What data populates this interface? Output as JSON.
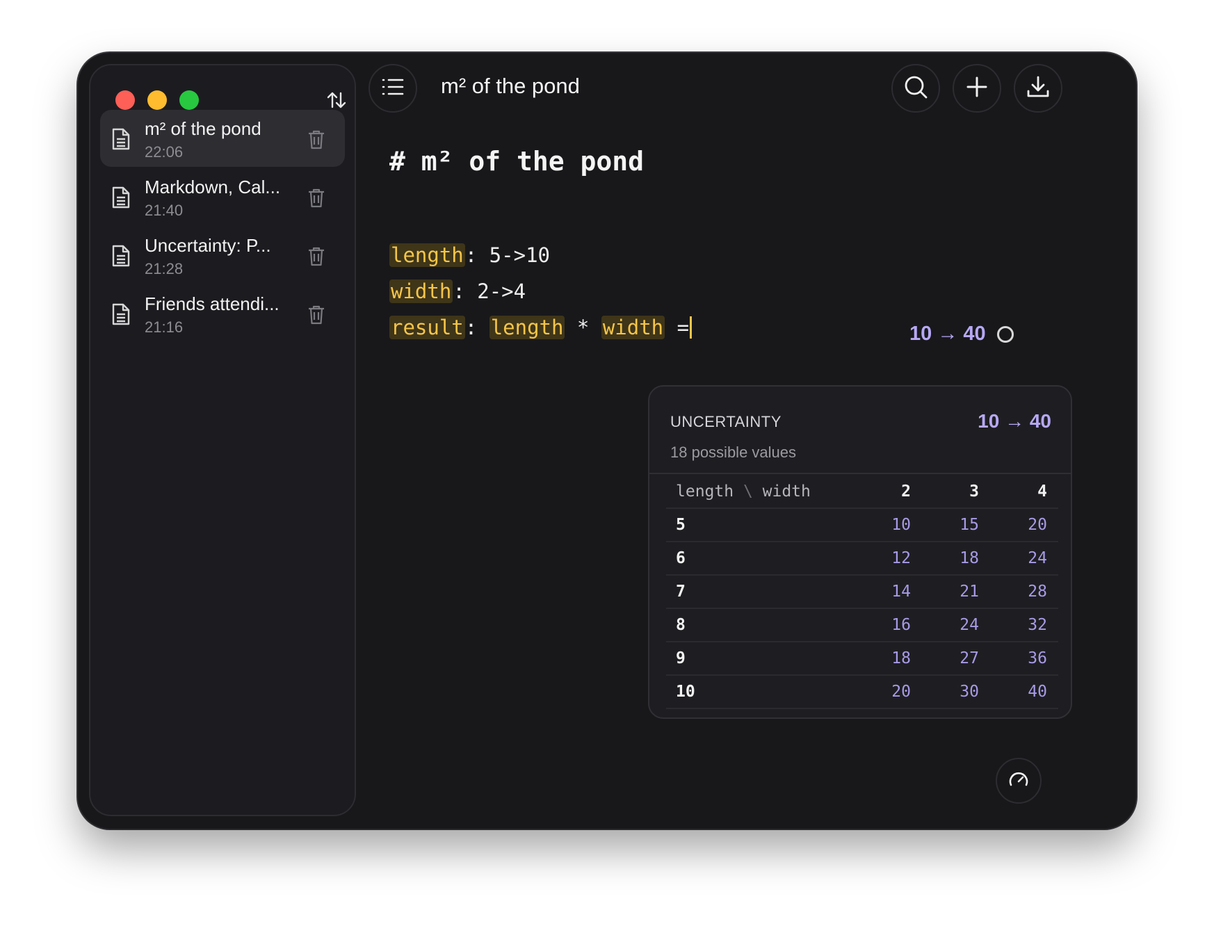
{
  "window": {
    "title": "m² of the pond"
  },
  "sidebar": {
    "sort_icon": "sort-icon",
    "notes": [
      {
        "title": "m² of the pond",
        "time": "22:06",
        "active": true
      },
      {
        "title": "Markdown, Cal...",
        "time": "21:40",
        "active": false
      },
      {
        "title": "Uncertainty: P...",
        "time": "21:28",
        "active": false
      },
      {
        "title": "Friends attendi...",
        "time": "21:16",
        "active": false
      }
    ]
  },
  "editor": {
    "heading": "# m² of the pond",
    "lines": [
      {
        "var": "length",
        "rest": ": 5->10"
      },
      {
        "var": "width",
        "rest": ": 2->4"
      }
    ],
    "result_line": {
      "var": "result",
      "colon": ": ",
      "a": "length",
      "op": " * ",
      "b": "width",
      "eq": " ="
    },
    "inline_result": "10 → 40"
  },
  "popup": {
    "label": "UNCERTAINTY",
    "range": "10 → 40",
    "count": "18 possible values",
    "corner_a": "length",
    "corner_sep": " \\ ",
    "corner_b": "width",
    "columns": [
      "2",
      "3",
      "4"
    ],
    "rows": [
      {
        "h": "5",
        "v": [
          "10",
          "15",
          "20"
        ]
      },
      {
        "h": "6",
        "v": [
          "12",
          "18",
          "24"
        ]
      },
      {
        "h": "7",
        "v": [
          "14",
          "21",
          "28"
        ]
      },
      {
        "h": "8",
        "v": [
          "16",
          "24",
          "32"
        ]
      },
      {
        "h": "9",
        "v": [
          "18",
          "27",
          "36"
        ]
      },
      {
        "h": "10",
        "v": [
          "20",
          "30",
          "40"
        ]
      }
    ]
  },
  "colors": {
    "accent": "#b7a8f4",
    "variable": "#f5c54a",
    "background": "#18181b"
  }
}
